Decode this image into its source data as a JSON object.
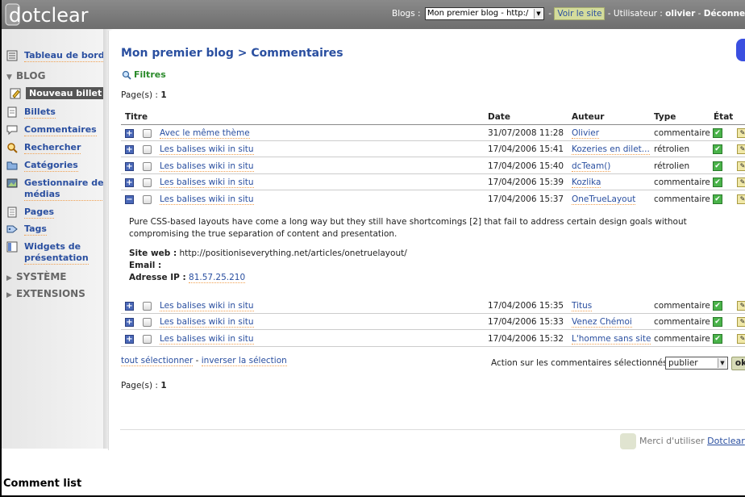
{
  "topbar": {
    "logo_text": "dotclear",
    "blogs_label": "Blogs :",
    "blog_select_value": "Mon premier blog - http:/",
    "sep1": "-",
    "view_site": "Voir le site",
    "user_label": "- Utilisateur :",
    "user_name": "olivier",
    "sep2": "-",
    "logout": "Déconnexio"
  },
  "sidebar": {
    "dashboard": "Tableau de bord",
    "blog_section": "BLOG",
    "new_post": "Nouveau billet",
    "items": [
      {
        "label": "Billets",
        "icon": "posts-icon"
      },
      {
        "label": "Commentaires",
        "icon": "comments-icon"
      },
      {
        "label": "Rechercher",
        "icon": "search-icon"
      },
      {
        "label": "Catégories",
        "icon": "categories-icon"
      },
      {
        "label": "Gestionnaire de",
        "label2": "médias",
        "icon": "media-icon"
      },
      {
        "label": "Pages",
        "icon": "pages-icon"
      },
      {
        "label": "Tags",
        "icon": "tags-icon"
      },
      {
        "label": "Widgets de",
        "label2": "présentation",
        "icon": "widgets-icon"
      }
    ],
    "system_section": "SYSTÈME",
    "extensions_section": "EXTENSIONS"
  },
  "main": {
    "title": "Mon premier blog > Commentaires",
    "filters": "Filtres",
    "pages_label": "Page(s) :",
    "pages_value": "1",
    "columns": [
      "Titre",
      "Date",
      "Auteur",
      "Type",
      "État"
    ],
    "rows": [
      {
        "title": "Avec le même thème",
        "date": "31/07/2008 11:28",
        "author": "Olivier",
        "type": "commentaire",
        "expanded": false
      },
      {
        "title": "Les balises wiki in situ",
        "date": "17/04/2006 15:41",
        "author": "Kozeries en dilet...",
        "type": "rétrolien",
        "expanded": false
      },
      {
        "title": "Les balises wiki in situ",
        "date": "17/04/2006 15:40",
        "author": "dcTeam()",
        "type": "rétrolien",
        "expanded": false
      },
      {
        "title": "Les balises wiki in situ",
        "date": "17/04/2006 15:39",
        "author": "Kozlika",
        "type": "commentaire",
        "expanded": false
      },
      {
        "title": "Les balises wiki in situ",
        "date": "17/04/2006 15:37",
        "author": "OneTrueLayout",
        "type": "commentaire",
        "expanded": true
      },
      {
        "title": "Les balises wiki in situ",
        "date": "17/04/2006 15:35",
        "author": "Titus",
        "type": "commentaire",
        "expanded": false
      },
      {
        "title": "Les balises wiki in situ",
        "date": "17/04/2006 15:33",
        "author": "Venez Chémoi",
        "type": "commentaire",
        "expanded": false
      },
      {
        "title": "Les balises wiki in situ",
        "date": "17/04/2006 15:32",
        "author": "L'homme sans site",
        "type": "commentaire",
        "expanded": false
      }
    ],
    "detail": {
      "text": "Pure CSS-based layouts have come a long way but they still have shortcomings [2] that fail to address certain design goals without compromising the true separation of content and presentation.",
      "site_label": "Site web :",
      "site_value": "http://positioniseverything.net/articles/onetruelayout/",
      "email_label": "Email :",
      "ip_label": "Adresse IP :",
      "ip_value": "81.57.25.210"
    },
    "select_all": "tout sélectionner",
    "sel_sep": "-",
    "invert_selection": "inverser la sélection",
    "action_label": "Action sur les commentaires sélectionnés :",
    "action_value": "publier",
    "ok": "ok"
  },
  "footer": {
    "thanks": "Merci d'utiliser",
    "link": "Dotclear"
  },
  "caption": "Comment list"
}
